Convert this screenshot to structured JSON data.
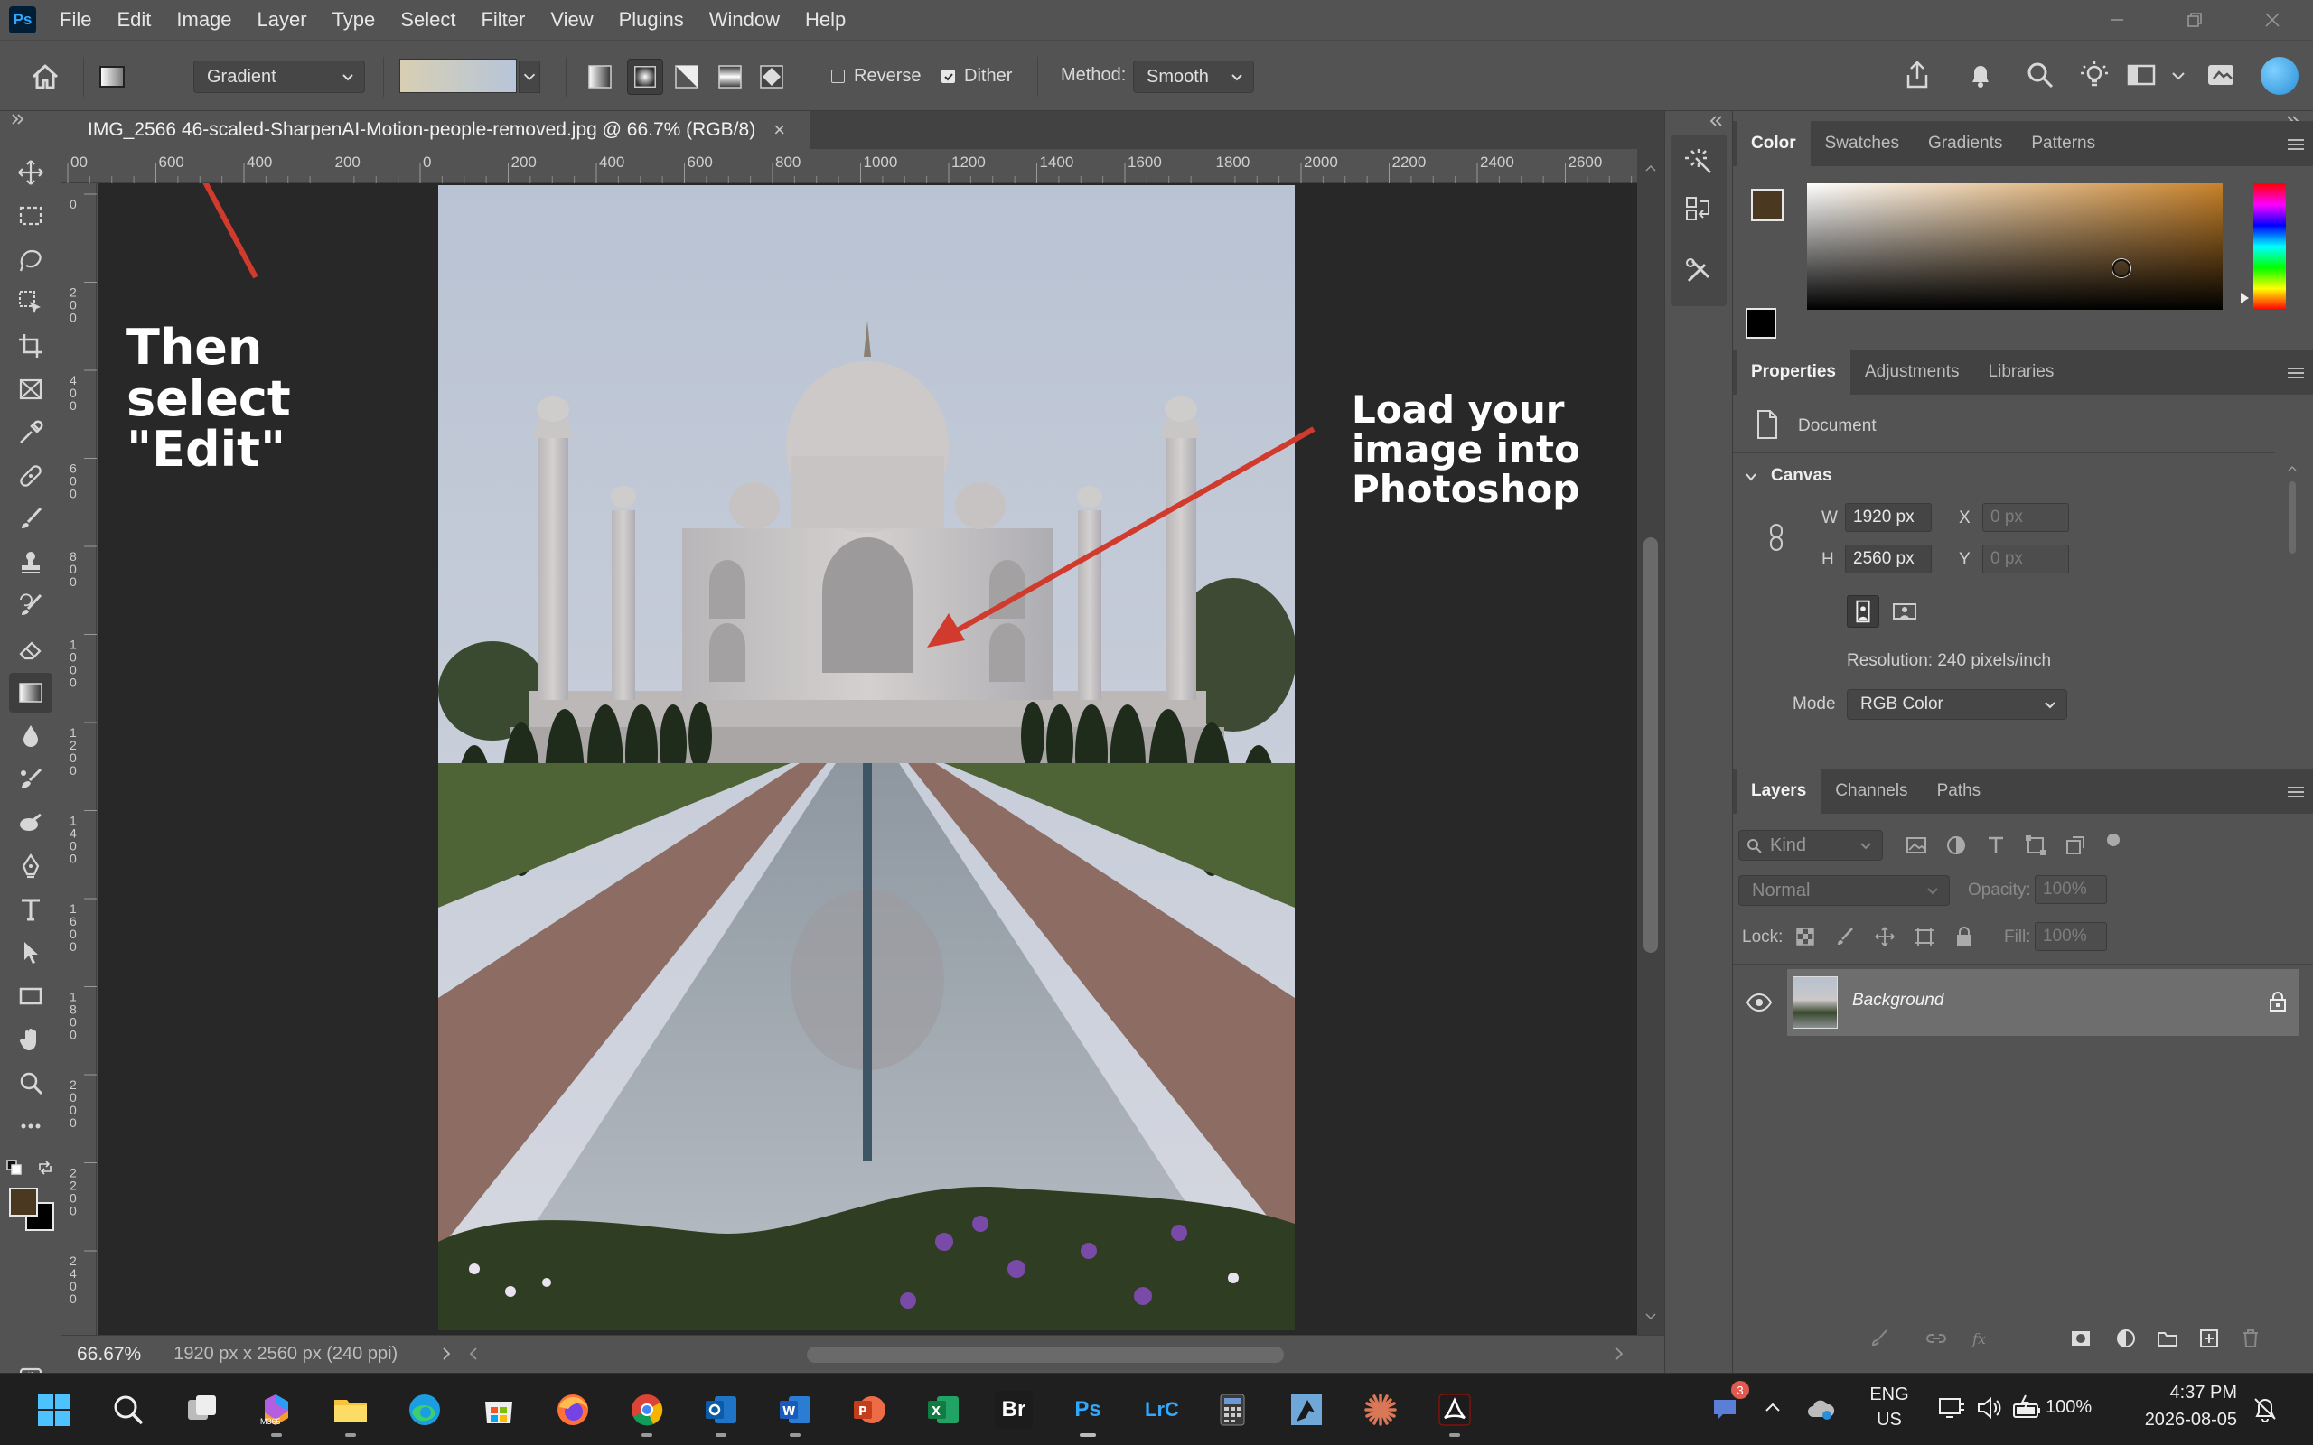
{
  "app": {
    "logo": "Ps"
  },
  "menu": [
    "File",
    "Edit",
    "Image",
    "Layer",
    "Type",
    "Select",
    "Filter",
    "View",
    "Plugins",
    "Window",
    "Help"
  ],
  "options": {
    "tool_preset": "Gradient",
    "reverse_label": "Reverse",
    "reverse_checked": false,
    "dither_label": "Dither",
    "dither_checked": true,
    "method_label": "Method:",
    "method_value": "Smooth"
  },
  "document": {
    "tab_title": "IMG_2566 46-scaled-SharpenAI-Motion-people-removed.jpg @ 66.7% (RGB/8)",
    "close_glyph": "×"
  },
  "ruler": {
    "top_labels": [
      "00",
      "600",
      "400",
      "200",
      "0",
      "200",
      "400",
      "600",
      "800",
      "1000",
      "1200",
      "1400",
      "1600",
      "1800",
      "2000",
      "2200",
      "2400",
      "2600"
    ],
    "left_labels": [
      "0",
      "200",
      "400",
      "600",
      "800",
      "1000",
      "1200",
      "1400",
      "1600",
      "1800",
      "2000",
      "2200",
      "2400"
    ]
  },
  "status": {
    "zoom": "66.67%",
    "doc_info": "1920 px x 2560 px (240 ppi)"
  },
  "annotations": {
    "edit_text": "Then select \"Edit\"",
    "load_text": "Load your image into Photoshop",
    "arrow_color": "#d13b2e"
  },
  "color_panel": {
    "tabs": [
      "Color",
      "Swatches",
      "Gradients",
      "Patterns"
    ],
    "foreground": "#4a3820",
    "background": "#000000",
    "hue_color": "#c8822a"
  },
  "properties_panel": {
    "tabs": [
      "Properties",
      "Adjustments",
      "Libraries"
    ],
    "document_label": "Document",
    "canvas_label": "Canvas",
    "w_label": "W",
    "w_value": "1920 px",
    "h_label": "H",
    "h_value": "2560 px",
    "x_label": "X",
    "x_value": "0 px",
    "y_label": "Y",
    "y_value": "0 px",
    "resolution": "Resolution: 240 pixels/inch",
    "mode_label": "Mode",
    "mode_value": "RGB Color"
  },
  "layers_panel": {
    "tabs": [
      "Layers",
      "Channels",
      "Paths"
    ],
    "kind": "Kind",
    "blend_mode": "Normal",
    "opacity_label": "Opacity:",
    "opacity_value": "100%",
    "lock_label": "Lock:",
    "fill_label": "Fill:",
    "fill_value": "100%",
    "layer_name": "Background"
  },
  "taskbar": {
    "apps": [
      "Start",
      "Search",
      "Task View",
      "Microsoft 365",
      "File Explorer",
      "Edge",
      "Microsoft Store",
      "Firefox",
      "Chrome",
      "Outlook",
      "Word",
      "PowerPoint",
      "Excel",
      "Bridge",
      "Photoshop",
      "Lightroom Classic",
      "Calculator",
      "Inkscape",
      "Claude",
      "Acrobat"
    ],
    "bridge_label": "Br",
    "ps_label": "Ps",
    "lrc_label": "LrC",
    "m365_label": "M365",
    "chat_badge": "3",
    "lang_top": "ENG",
    "lang_bottom": "US",
    "battery": "100%",
    "time": "4:37 PM",
    "date": "2026-08-05"
  }
}
